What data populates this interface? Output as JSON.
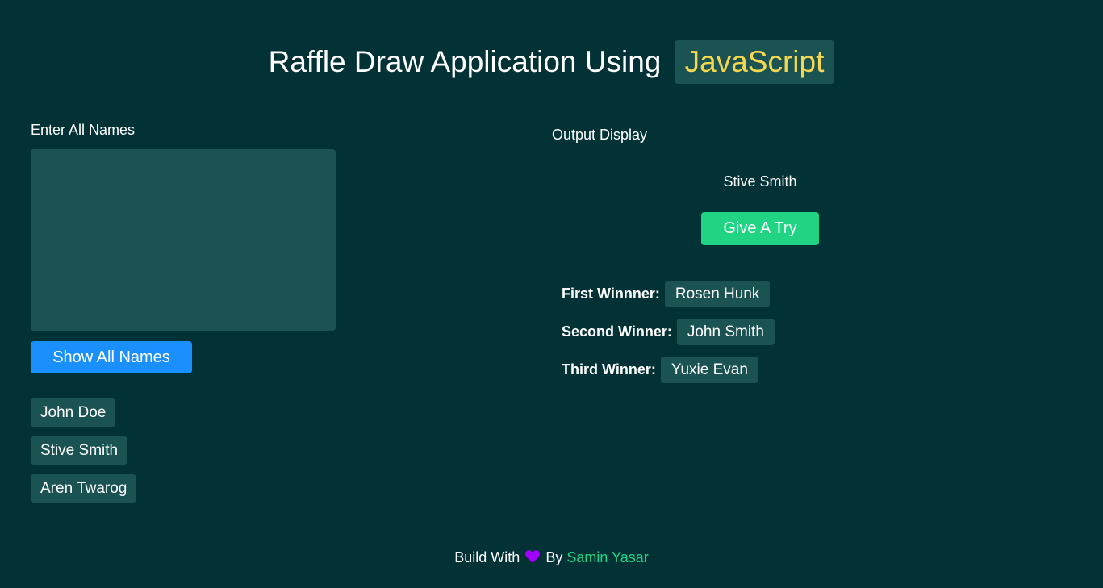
{
  "header": {
    "title_text": "Raffle Draw Application Using",
    "title_highlight": "JavaScript"
  },
  "input_section": {
    "label": "Enter All Names",
    "textarea_value": "",
    "button_label": "Show All Names",
    "names": [
      "John Doe",
      "Stive Smith",
      "Aren Twarog"
    ]
  },
  "output_section": {
    "label": "Output Display",
    "current_name": "Stive Smith",
    "button_label": "Give A Try",
    "winners": [
      {
        "label": "First Winnner:",
        "name": "Rosen Hunk"
      },
      {
        "label": "Second Winner:",
        "name": "John Smith"
      },
      {
        "label": "Third Winner:",
        "name": "Yuxie Evan"
      }
    ]
  },
  "footer": {
    "prefix": "Build With",
    "icon": "heart-icon",
    "middle": "By",
    "author": "Samin Yasar"
  },
  "colors": {
    "background": "#023136",
    "panel": "#1a5352",
    "highlight_text": "#f5d651",
    "primary_button": "#1a90ff",
    "success_button": "#21d483",
    "heart": "#a100ff",
    "author_link": "#21d483"
  }
}
